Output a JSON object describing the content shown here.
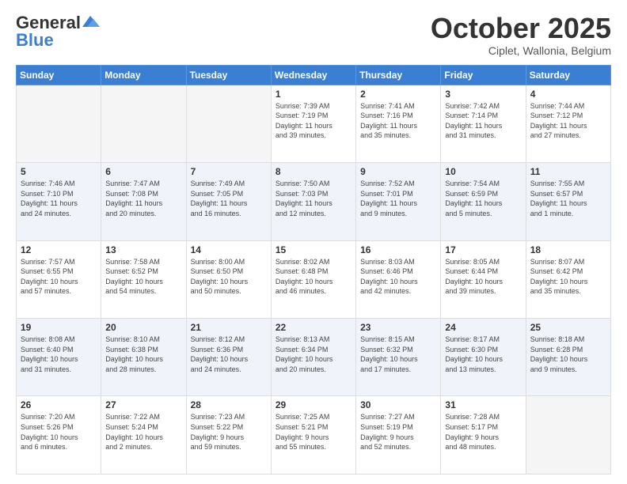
{
  "header": {
    "logo_general": "General",
    "logo_blue": "Blue",
    "month_title": "October 2025",
    "location": "Ciplet, Wallonia, Belgium"
  },
  "weekdays": [
    "Sunday",
    "Monday",
    "Tuesday",
    "Wednesday",
    "Thursday",
    "Friday",
    "Saturday"
  ],
  "weeks": [
    [
      {
        "day": "",
        "info": ""
      },
      {
        "day": "",
        "info": ""
      },
      {
        "day": "",
        "info": ""
      },
      {
        "day": "1",
        "info": "Sunrise: 7:39 AM\nSunset: 7:19 PM\nDaylight: 11 hours\nand 39 minutes."
      },
      {
        "day": "2",
        "info": "Sunrise: 7:41 AM\nSunset: 7:16 PM\nDaylight: 11 hours\nand 35 minutes."
      },
      {
        "day": "3",
        "info": "Sunrise: 7:42 AM\nSunset: 7:14 PM\nDaylight: 11 hours\nand 31 minutes."
      },
      {
        "day": "4",
        "info": "Sunrise: 7:44 AM\nSunset: 7:12 PM\nDaylight: 11 hours\nand 27 minutes."
      }
    ],
    [
      {
        "day": "5",
        "info": "Sunrise: 7:46 AM\nSunset: 7:10 PM\nDaylight: 11 hours\nand 24 minutes."
      },
      {
        "day": "6",
        "info": "Sunrise: 7:47 AM\nSunset: 7:08 PM\nDaylight: 11 hours\nand 20 minutes."
      },
      {
        "day": "7",
        "info": "Sunrise: 7:49 AM\nSunset: 7:05 PM\nDaylight: 11 hours\nand 16 minutes."
      },
      {
        "day": "8",
        "info": "Sunrise: 7:50 AM\nSunset: 7:03 PM\nDaylight: 11 hours\nand 12 minutes."
      },
      {
        "day": "9",
        "info": "Sunrise: 7:52 AM\nSunset: 7:01 PM\nDaylight: 11 hours\nand 9 minutes."
      },
      {
        "day": "10",
        "info": "Sunrise: 7:54 AM\nSunset: 6:59 PM\nDaylight: 11 hours\nand 5 minutes."
      },
      {
        "day": "11",
        "info": "Sunrise: 7:55 AM\nSunset: 6:57 PM\nDaylight: 11 hours\nand 1 minute."
      }
    ],
    [
      {
        "day": "12",
        "info": "Sunrise: 7:57 AM\nSunset: 6:55 PM\nDaylight: 10 hours\nand 57 minutes."
      },
      {
        "day": "13",
        "info": "Sunrise: 7:58 AM\nSunset: 6:52 PM\nDaylight: 10 hours\nand 54 minutes."
      },
      {
        "day": "14",
        "info": "Sunrise: 8:00 AM\nSunset: 6:50 PM\nDaylight: 10 hours\nand 50 minutes."
      },
      {
        "day": "15",
        "info": "Sunrise: 8:02 AM\nSunset: 6:48 PM\nDaylight: 10 hours\nand 46 minutes."
      },
      {
        "day": "16",
        "info": "Sunrise: 8:03 AM\nSunset: 6:46 PM\nDaylight: 10 hours\nand 42 minutes."
      },
      {
        "day": "17",
        "info": "Sunrise: 8:05 AM\nSunset: 6:44 PM\nDaylight: 10 hours\nand 39 minutes."
      },
      {
        "day": "18",
        "info": "Sunrise: 8:07 AM\nSunset: 6:42 PM\nDaylight: 10 hours\nand 35 minutes."
      }
    ],
    [
      {
        "day": "19",
        "info": "Sunrise: 8:08 AM\nSunset: 6:40 PM\nDaylight: 10 hours\nand 31 minutes."
      },
      {
        "day": "20",
        "info": "Sunrise: 8:10 AM\nSunset: 6:38 PM\nDaylight: 10 hours\nand 28 minutes."
      },
      {
        "day": "21",
        "info": "Sunrise: 8:12 AM\nSunset: 6:36 PM\nDaylight: 10 hours\nand 24 minutes."
      },
      {
        "day": "22",
        "info": "Sunrise: 8:13 AM\nSunset: 6:34 PM\nDaylight: 10 hours\nand 20 minutes."
      },
      {
        "day": "23",
        "info": "Sunrise: 8:15 AM\nSunset: 6:32 PM\nDaylight: 10 hours\nand 17 minutes."
      },
      {
        "day": "24",
        "info": "Sunrise: 8:17 AM\nSunset: 6:30 PM\nDaylight: 10 hours\nand 13 minutes."
      },
      {
        "day": "25",
        "info": "Sunrise: 8:18 AM\nSunset: 6:28 PM\nDaylight: 10 hours\nand 9 minutes."
      }
    ],
    [
      {
        "day": "26",
        "info": "Sunrise: 7:20 AM\nSunset: 5:26 PM\nDaylight: 10 hours\nand 6 minutes."
      },
      {
        "day": "27",
        "info": "Sunrise: 7:22 AM\nSunset: 5:24 PM\nDaylight: 10 hours\nand 2 minutes."
      },
      {
        "day": "28",
        "info": "Sunrise: 7:23 AM\nSunset: 5:22 PM\nDaylight: 9 hours\nand 59 minutes."
      },
      {
        "day": "29",
        "info": "Sunrise: 7:25 AM\nSunset: 5:21 PM\nDaylight: 9 hours\nand 55 minutes."
      },
      {
        "day": "30",
        "info": "Sunrise: 7:27 AM\nSunset: 5:19 PM\nDaylight: 9 hours\nand 52 minutes."
      },
      {
        "day": "31",
        "info": "Sunrise: 7:28 AM\nSunset: 5:17 PM\nDaylight: 9 hours\nand 48 minutes."
      },
      {
        "day": "",
        "info": ""
      }
    ]
  ]
}
